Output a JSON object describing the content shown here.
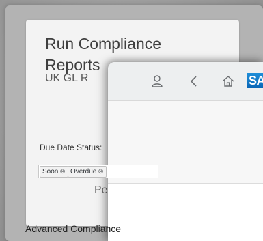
{
  "tile": {
    "title": "Run Compliance Reports",
    "subtitle": "UK GL R",
    "footer": "Pe"
  },
  "shell": {
    "icons": [
      "user-icon",
      "back-icon",
      "home-icon"
    ],
    "logo_text": "SA"
  },
  "filters": {
    "due_date_label": "Due Date Status:",
    "tokens": [
      {
        "label": "Soon",
        "remove": "⊗"
      },
      {
        "label": "Overdue",
        "remove": "⊗"
      }
    ]
  },
  "content": {
    "section_title": "Advanced Compliance"
  },
  "colors": {
    "brand": "#0a6ed1",
    "shell_bg": "#edeff0",
    "tile_bg": "#f3f3f3"
  }
}
